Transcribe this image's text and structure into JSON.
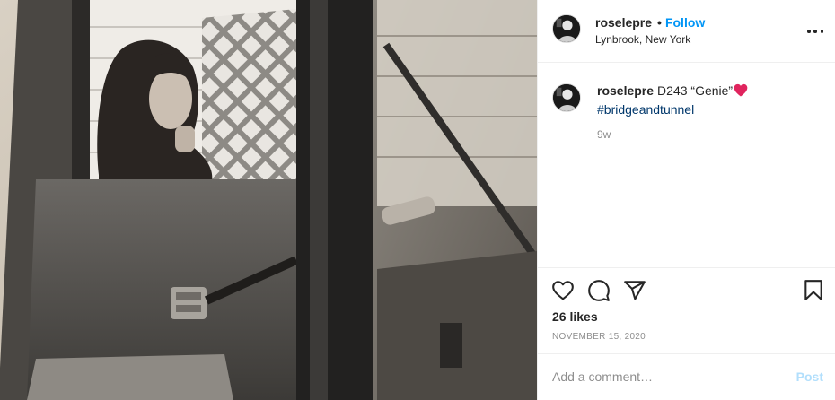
{
  "post": {
    "username": "roselepre",
    "follow_label": "Follow",
    "separator": "•",
    "location": "Lynbrook, New York",
    "caption_text": "D243 “Genie”",
    "caption_emoji": "red-heart-emoji",
    "hashtag": "#bridgeandtunnel",
    "time_ago": "9w",
    "likes": "26 likes",
    "date": "NOVEMBER 15, 2020"
  },
  "comment_box": {
    "placeholder": "Add a comment…",
    "post_label": "Post"
  },
  "icons": {
    "more": "more-options-icon",
    "like": "heart-icon",
    "comment": "comment-bubble-icon",
    "share": "paper-plane-icon",
    "save": "bookmark-icon"
  },
  "colors": {
    "accent": "#0095f6",
    "hashtag": "#00376b",
    "muted": "#8e8e8e",
    "post_disabled": "#b2dffc",
    "heart": "#ed4956"
  }
}
